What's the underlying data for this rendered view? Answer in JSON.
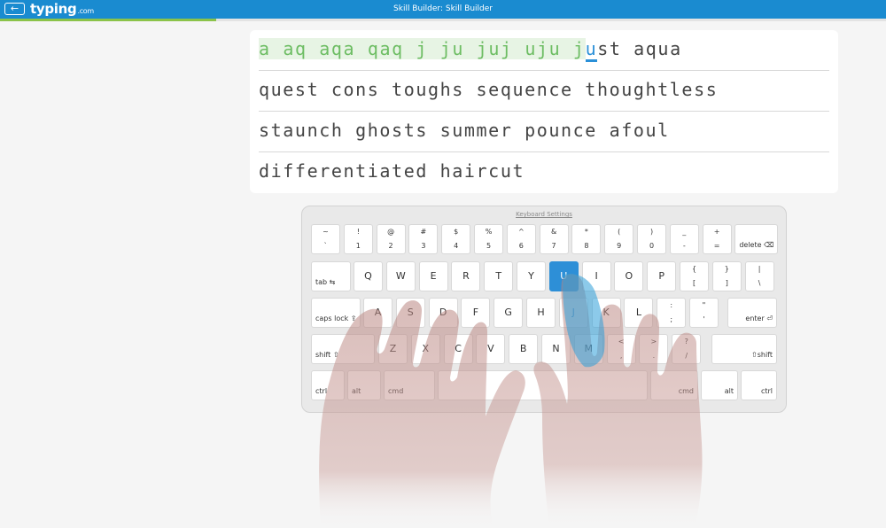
{
  "header": {
    "back_icon": "arrow-left-icon",
    "back_glyph": "←",
    "logo": "typing",
    "logo_tld": ".com",
    "title": "Skill Builder: Skill Builder"
  },
  "progress": {
    "fraction": 0.244
  },
  "lesson": {
    "typed": [
      "a",
      "aq",
      "aqa",
      "qaq",
      "j",
      "ju",
      "juj",
      "uju"
    ],
    "current_word_typed": "j",
    "current_char": "u",
    "current_word_rest": "st",
    "rest_line1": "aqua",
    "line2": "quest cons toughs sequence thoughtless",
    "line3": "staunch ghosts summer pounce afoul",
    "line4": "differentiated haircut"
  },
  "keyboard": {
    "settings_label": "Keyboard Settings",
    "active_key": "U",
    "row1": [
      {
        "top": "~",
        "bot": "`"
      },
      {
        "top": "!",
        "bot": "1"
      },
      {
        "top": "@",
        "bot": "2"
      },
      {
        "top": "#",
        "bot": "3"
      },
      {
        "top": "$",
        "bot": "4"
      },
      {
        "top": "%",
        "bot": "5"
      },
      {
        "top": "^",
        "bot": "6"
      },
      {
        "top": "&",
        "bot": "7"
      },
      {
        "top": "*",
        "bot": "8"
      },
      {
        "top": "(",
        "bot": "9"
      },
      {
        "top": ")",
        "bot": "0"
      },
      {
        "top": "_",
        "bot": "-"
      },
      {
        "top": "+",
        "bot": "="
      }
    ],
    "delete": "delete ⌫",
    "tab": "tab ⇆",
    "row2": [
      "Q",
      "W",
      "E",
      "R",
      "T",
      "Y",
      "U",
      "I",
      "O",
      "P"
    ],
    "row2_sym": [
      {
        "top": "{",
        "bot": "["
      },
      {
        "top": "}",
        "bot": "]"
      },
      {
        "top": "|",
        "bot": "\\"
      }
    ],
    "caps": "caps lock ⇪",
    "row3": [
      "A",
      "S",
      "D",
      "F",
      "G",
      "H",
      "J",
      "K",
      "L"
    ],
    "row3_sym": [
      {
        "top": ":",
        "bot": ";"
      },
      {
        "top": "\"",
        "bot": "'"
      }
    ],
    "enter": "enter ⏎",
    "shift_left": "shift ⇧",
    "row4": [
      "Z",
      "X",
      "C",
      "V",
      "B",
      "N",
      "M"
    ],
    "row4_sym": [
      {
        "top": "<",
        "bot": ","
      },
      {
        "top": ">",
        "bot": "."
      },
      {
        "top": "?",
        "bot": "/"
      }
    ],
    "shift_right": "⇧shift",
    "ctrl": "ctrl",
    "alt": "alt",
    "cmd": "cmd"
  },
  "colors": {
    "accent": "#1a8bd0",
    "typed": "#6dbd63",
    "progress": "#8bc34a"
  }
}
